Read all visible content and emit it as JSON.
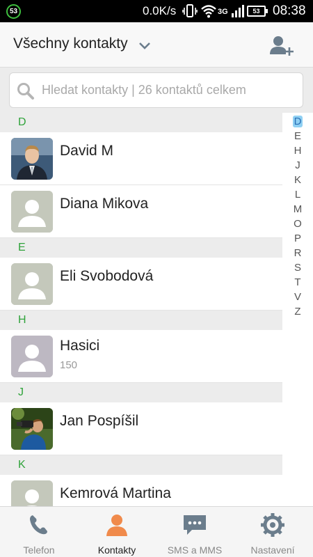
{
  "status_bar": {
    "badge": "53",
    "net_speed": "0.0K/s",
    "network_type": "3G",
    "battery": "53",
    "time": "08:38"
  },
  "header": {
    "title": "Všechny kontakty",
    "add_contact_icon": "add-person-icon"
  },
  "search": {
    "placeholder": "Hledat kontakty | 26 kontaktů celkem",
    "value": ""
  },
  "sections": [
    {
      "letter": "D",
      "contacts": [
        {
          "name": "David M",
          "avatar": "photo-man-suit"
        },
        {
          "name": "Diana Mikova",
          "avatar": "placeholder"
        }
      ]
    },
    {
      "letter": "E",
      "contacts": [
        {
          "name": "Eli Svobodová",
          "avatar": "placeholder"
        }
      ]
    },
    {
      "letter": "H",
      "contacts": [
        {
          "name": "Hasici",
          "number": "150",
          "avatar": "placeholder"
        }
      ]
    },
    {
      "letter": "J",
      "contacts": [
        {
          "name": "Jan Pospíšil",
          "avatar": "photo-photographer"
        }
      ]
    },
    {
      "letter": "K",
      "contacts": [
        {
          "name": "Kemrová Martina",
          "avatar": "placeholder"
        }
      ]
    }
  ],
  "alphabet_index": {
    "letters": [
      "D",
      "E",
      "H",
      "J",
      "K",
      "L",
      "M",
      "O",
      "P",
      "R",
      "S",
      "T",
      "V",
      "Z"
    ],
    "active": "D"
  },
  "bottom_nav": [
    {
      "label": "Telefon",
      "icon": "phone-icon",
      "active": false
    },
    {
      "label": "Kontakty",
      "icon": "person-icon",
      "active": true
    },
    {
      "label": "SMS a MMS",
      "icon": "message-icon",
      "active": false
    },
    {
      "label": "Nastavení",
      "icon": "gear-icon",
      "active": false
    }
  ],
  "colors": {
    "section_letter": "#2fa33a",
    "active_tab_icon": "#f08a4b",
    "inactive_icon": "#6b7d8c",
    "placeholder_avatar": "#c4c8bb"
  }
}
